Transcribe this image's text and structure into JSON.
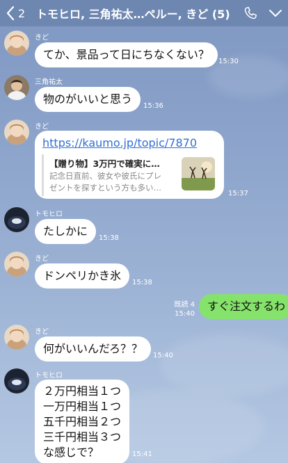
{
  "header": {
    "back_count": "2",
    "title": "トモヒロ, 三角祐太…ペルー, きど (5)",
    "phone_icon": "phone-icon",
    "menu_icon": "chevron-down-icon",
    "bg_color": "#6e87b1"
  },
  "messages": [
    {
      "sender": "きど",
      "text": "てか、景品って日にちなくない？",
      "time": "15:30"
    },
    {
      "sender": "三角祐太",
      "text": "物のがいいと思う",
      "time": "15:36"
    },
    {
      "sender": "きど",
      "url": "https://kaumo.jp/topic/7870",
      "preview_title": "【贈り物】3万円で確実に…",
      "preview_desc_1": "記念日直前、彼女や彼氏にプレ",
      "preview_desc_2": "ゼントを探すという方も多い…",
      "time": "15:37"
    },
    {
      "sender": "トモヒロ",
      "text": "たしかに",
      "time": "15:38"
    },
    {
      "sender": "きど",
      "text": "ドンペリかき氷",
      "time": "15:38"
    },
    {
      "sender": "me",
      "text": "すぐ注文するわ",
      "read": "既読 4",
      "time": "15:40"
    },
    {
      "sender": "きど",
      "text": "何がいいんだろ？？",
      "time": "15:40"
    },
    {
      "sender": "トモヒロ",
      "lines": [
        "２万円相当１つ",
        "一万円相当１つ",
        "五千円相当２つ",
        "三千円相当３つ",
        "な感じで？"
      ],
      "time": "15:41"
    }
  ],
  "colors": {
    "own_bubble": "#85e36b",
    "other_bubble": "#ffffff",
    "link": "#2f6fd6"
  }
}
